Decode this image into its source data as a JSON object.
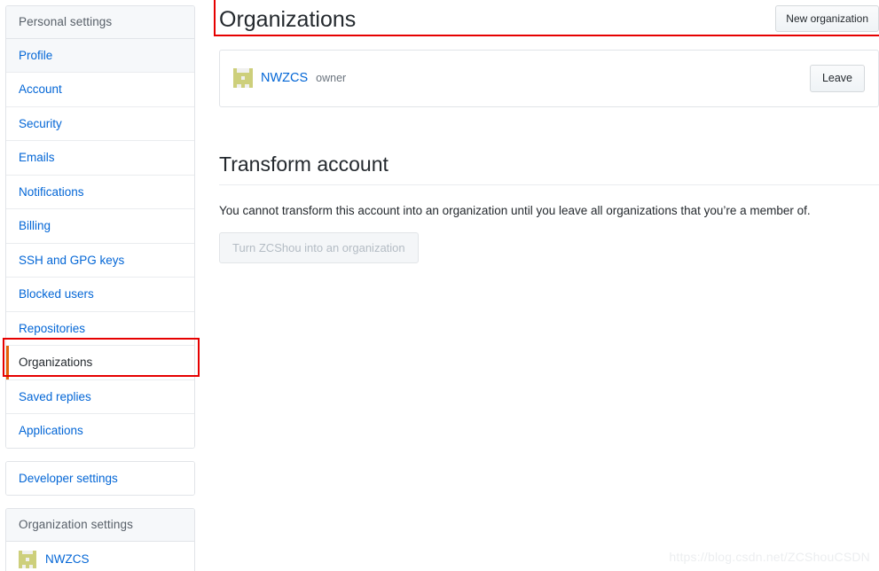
{
  "sidebar": {
    "groups": [
      {
        "name": "personal-settings",
        "header": "Personal settings",
        "items": [
          {
            "label": "Profile",
            "state": "shaded"
          },
          {
            "label": "Account",
            "state": "normal"
          },
          {
            "label": "Security",
            "state": "normal"
          },
          {
            "label": "Emails",
            "state": "normal"
          },
          {
            "label": "Notifications",
            "state": "normal"
          },
          {
            "label": "Billing",
            "state": "normal"
          },
          {
            "label": "SSH and GPG keys",
            "state": "normal"
          },
          {
            "label": "Blocked users",
            "state": "normal"
          },
          {
            "label": "Repositories",
            "state": "normal"
          },
          {
            "label": "Organizations",
            "state": "selected"
          },
          {
            "label": "Saved replies",
            "state": "normal"
          },
          {
            "label": "Applications",
            "state": "normal"
          }
        ]
      },
      {
        "name": "developer-settings",
        "header": null,
        "items": [
          {
            "label": "Developer settings",
            "state": "normal"
          }
        ]
      },
      {
        "name": "organization-settings",
        "header": "Organization settings",
        "items": [
          {
            "label": "NWZCS",
            "state": "normal",
            "avatar": "identicon"
          }
        ]
      }
    ]
  },
  "main": {
    "title": "Organizations",
    "new_org_button": "New organization",
    "organizations": [
      {
        "name": "NWZCS",
        "role": "owner",
        "avatar": "identicon",
        "action_label": "Leave"
      }
    ],
    "transform": {
      "heading": "Transform account",
      "description": "You cannot transform this account into an organization until you leave all organizations that you’re a member of.",
      "button_label": "Turn ZCShou into an organization",
      "button_disabled": true
    }
  },
  "annotations": {
    "header_highlight_color": "#e60000",
    "sidebar_highlight_color": "#e60000",
    "selected_item_accent": "#e36209"
  },
  "watermark": "https://blog.csdn.net/ZCShouCSDN",
  "colors": {
    "link": "#0366d6",
    "text": "#24292e",
    "muted": "#6a737d",
    "border": "#e1e4e8",
    "panel_bg": "#f6f8fa",
    "identicon": "#cdcf7b"
  }
}
